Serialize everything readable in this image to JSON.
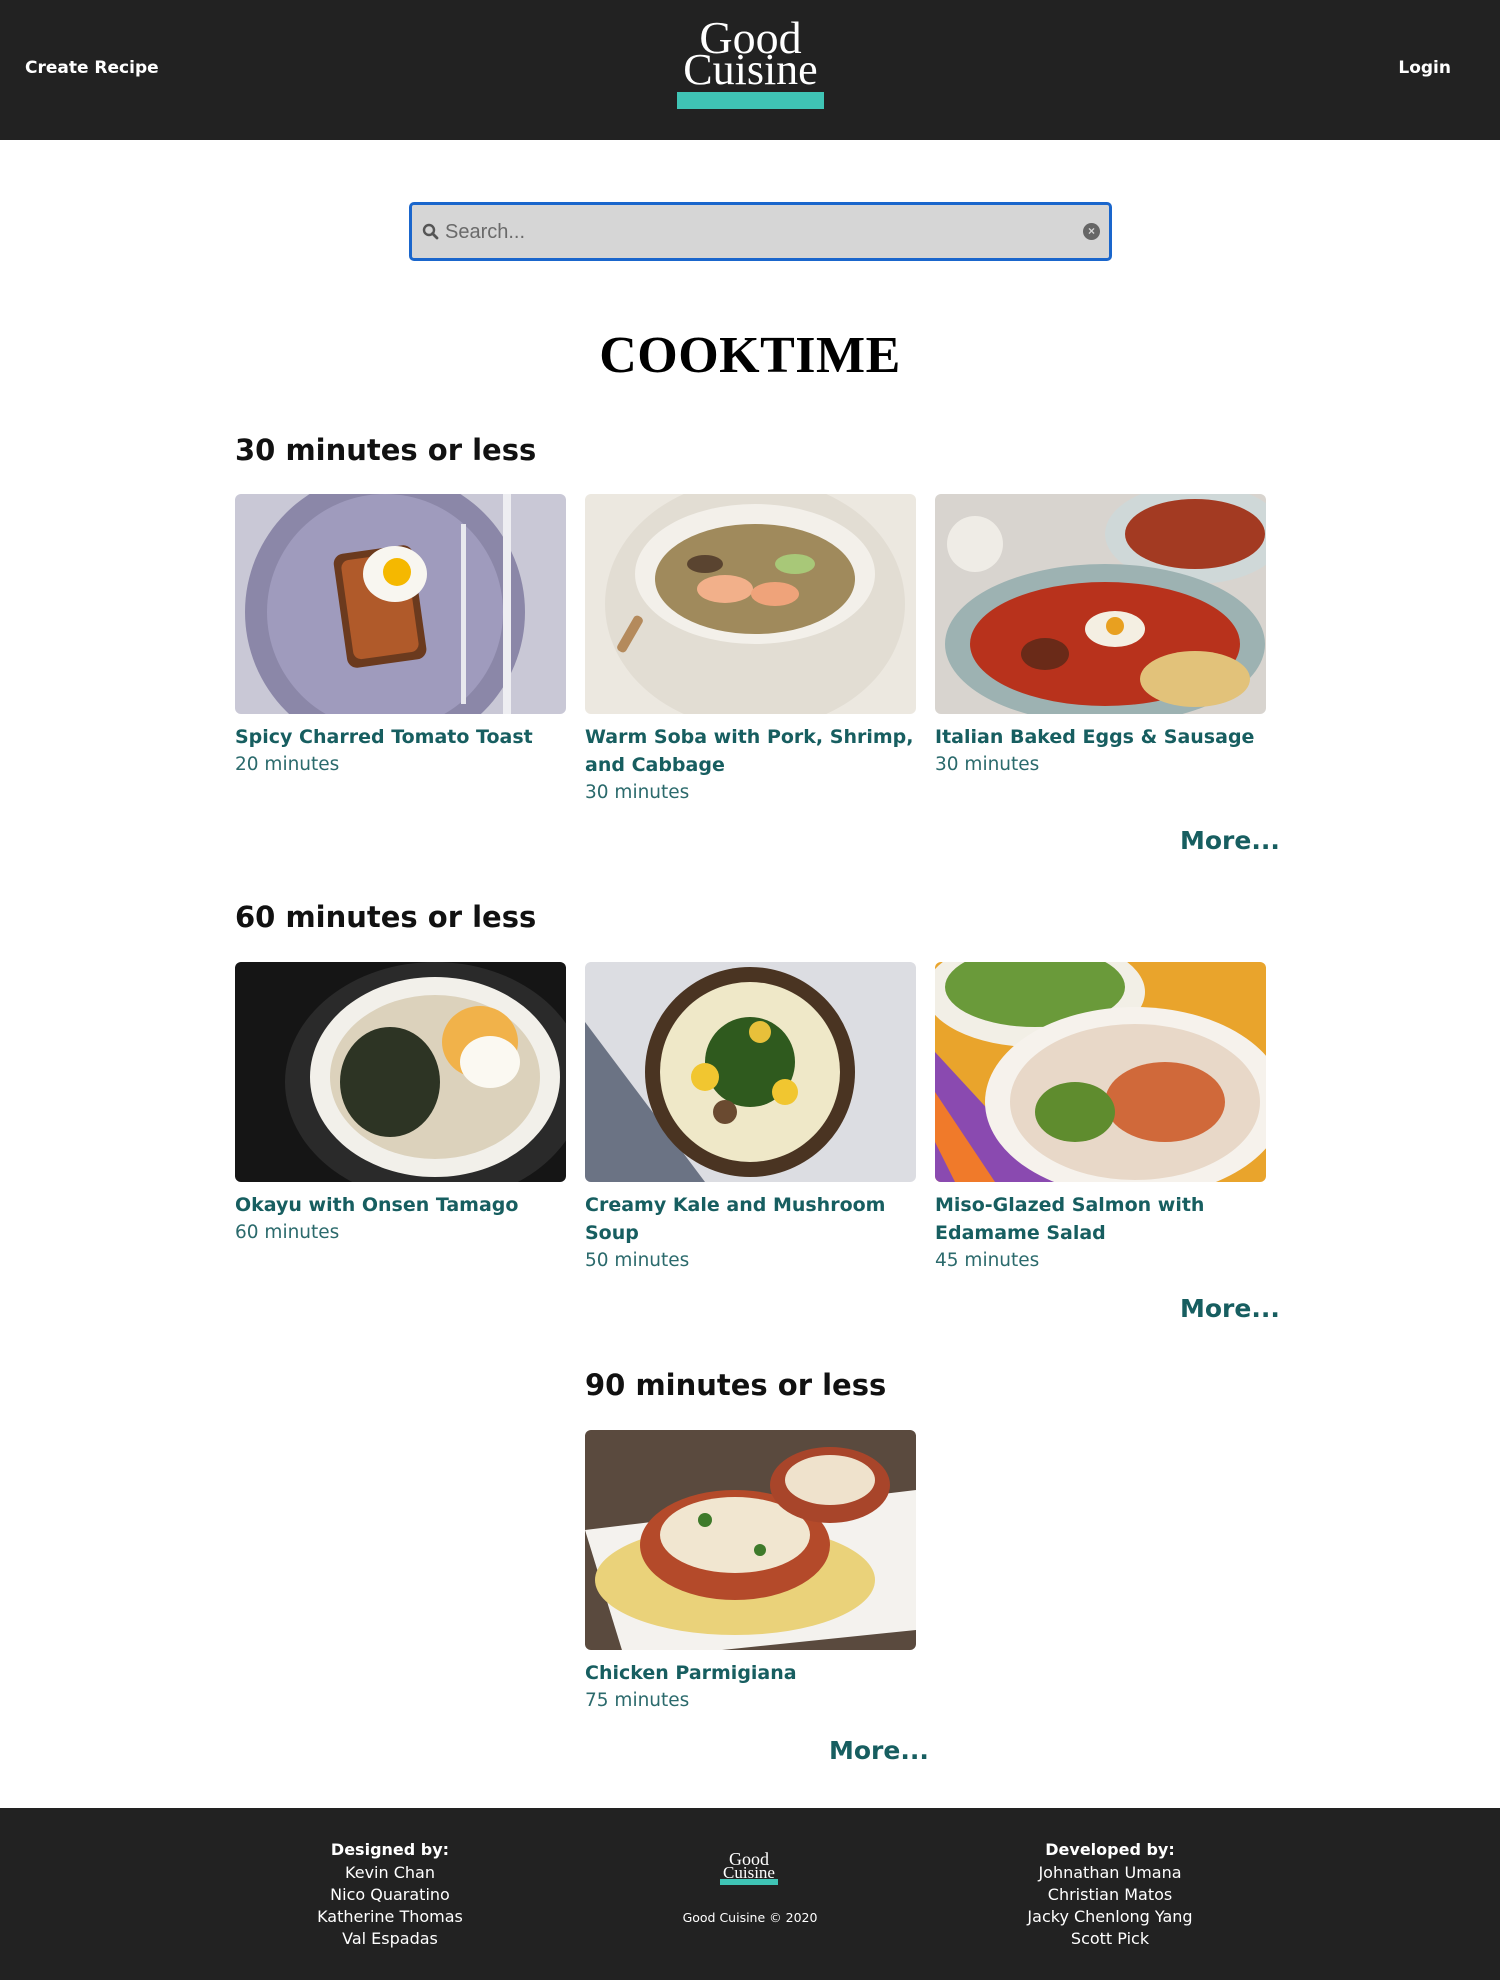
{
  "header": {
    "create_recipe": "Create Recipe",
    "login": "Login",
    "logo_line1": "Good",
    "logo_line2": "Cuisine",
    "accent": "#3fc4b5"
  },
  "search": {
    "placeholder": "Search..."
  },
  "page": {
    "title": "COOKTIME"
  },
  "sections": [
    {
      "heading": "30 minutes or less",
      "more": "More...",
      "recipes": [
        {
          "title": "Spicy Charred Tomato Toast",
          "time": "20 minutes"
        },
        {
          "title": "Warm Soba with Pork, Shrimp, and Cabbage",
          "time": "30 minutes"
        },
        {
          "title": "Italian Baked Eggs & Sausage",
          "time": "30 minutes"
        }
      ]
    },
    {
      "heading": "60 minutes or less",
      "more": "More...",
      "recipes": [
        {
          "title": "Okayu with Onsen Tamago",
          "time": "60 minutes"
        },
        {
          "title": "Creamy Kale and Mushroom Soup",
          "time": "50 minutes"
        },
        {
          "title": "Miso-Glazed Salmon with Edamame Salad",
          "time": "45 minutes"
        }
      ]
    },
    {
      "heading": "90 minutes or less",
      "more": "More...",
      "recipes": [
        {
          "title": "Chicken Parmigiana",
          "time": "75 minutes"
        }
      ]
    }
  ],
  "footer": {
    "designed_by_label": "Designed by:",
    "designers": [
      "Kevin Chan",
      "Nico Quaratino",
      "Katherine Thomas",
      "Val Espadas"
    ],
    "developed_by_label": "Developed by:",
    "developers": [
      "Johnathan Umana",
      "Christian Matos",
      "Jacky Chenlong Yang",
      "Scott Pick"
    ],
    "logo_line1": "Good",
    "logo_line2": "Cuisine",
    "copyright": "Good Cuisine © 2020"
  }
}
